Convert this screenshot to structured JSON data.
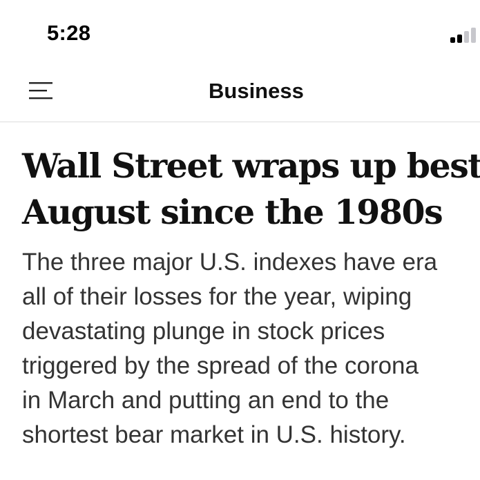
{
  "status_bar": {
    "time": "5:28",
    "signal_icon": "cellular-signal-icon"
  },
  "nav": {
    "menu_icon": "hamburger-menu-icon",
    "section_title": "Business"
  },
  "article": {
    "headline_lines": [
      "Wall Street wraps up best",
      "August since the 1980s"
    ],
    "dek_lines": [
      "The three major U.S. indexes have era",
      "all of their losses for the year, wiping",
      "devastating plunge in stock prices",
      "triggered by the spread of the corona",
      "in March and putting an end to the",
      "shortest bear market in U.S. history."
    ]
  },
  "colors": {
    "text": "#111111",
    "dek_text": "#333333",
    "divider": "#dcdcdc",
    "signal_active": "#000000",
    "signal_inactive": "#c7c7cc"
  }
}
